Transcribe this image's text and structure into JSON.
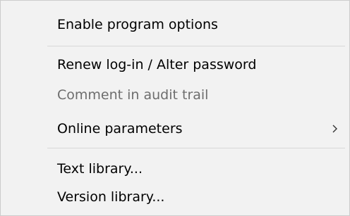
{
  "menu": {
    "items": [
      {
        "label": "Enable program options",
        "enabled": true
      },
      {
        "label": "Renew log-in / Alter password",
        "enabled": true
      },
      {
        "label": "Comment in audit trail",
        "enabled": false
      },
      {
        "label": "Online parameters",
        "enabled": true,
        "has_submenu": true
      },
      {
        "label": "Text library...",
        "enabled": true
      },
      {
        "label": "Version library...",
        "enabled": true
      }
    ],
    "submenu_icon": "chevron-right-icon",
    "colors": {
      "background": "#f2f2f2",
      "text": "#000000",
      "disabled_text": "#6d6d6d",
      "separator": "#d7d7d7"
    }
  }
}
